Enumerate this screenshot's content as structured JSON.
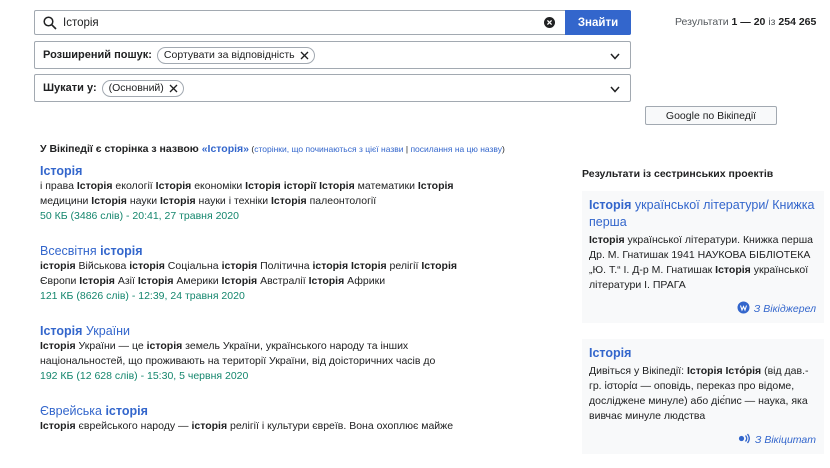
{
  "search": {
    "value": "Історія",
    "button_label": "Знайти"
  },
  "results_count": {
    "prefix": "Результати ",
    "range": "1 — 20",
    "middle": " із ",
    "total": "254 265"
  },
  "advanced": {
    "label": "Розширений пошук:",
    "chip": "Сортувати за відповідність"
  },
  "namespace": {
    "label": "Шукати у:",
    "chip": "(Основний)"
  },
  "google_button": "Google по Вікіпедії",
  "page_exists": {
    "prefix": "У Вікіпедії є сторінка з назвою ",
    "link": "«Історія»",
    "open": " (",
    "starting": "сторінки, що починаються з цієї назви",
    "separator": " | ",
    "links_here": "посилання на цю назву",
    "close": ")"
  },
  "results": [
    {
      "title": [
        {
          "t": "Історія",
          "b": true
        }
      ],
      "lines": [
        [
          {
            "t": "і права "
          },
          {
            "t": "Історія",
            "b": true
          },
          {
            "t": " екології "
          },
          {
            "t": "Історія",
            "b": true
          },
          {
            "t": " економіки "
          },
          {
            "t": "Історія історії Історія",
            "b": true
          },
          {
            "t": " математики "
          },
          {
            "t": "Історія",
            "b": true
          }
        ],
        [
          {
            "t": "медицини "
          },
          {
            "t": "Історія",
            "b": true
          },
          {
            "t": " науки "
          },
          {
            "t": "Історія",
            "b": true
          },
          {
            "t": " науки і техніки "
          },
          {
            "t": "Історія",
            "b": true
          },
          {
            "t": " палеонтології"
          }
        ]
      ],
      "meta": "50 КБ (3486 слів) - 20:41, 27 травня 2020"
    },
    {
      "title": [
        {
          "t": "Всесвітня "
        },
        {
          "t": "історія",
          "b": true
        }
      ],
      "lines": [
        [
          {
            "t": "історія",
            "b": true
          },
          {
            "t": " Військова "
          },
          {
            "t": "історія",
            "b": true
          },
          {
            "t": " Соціальна "
          },
          {
            "t": "історія",
            "b": true
          },
          {
            "t": " Політична "
          },
          {
            "t": "історія Історія",
            "b": true
          },
          {
            "t": " релігії "
          },
          {
            "t": "Історія",
            "b": true
          }
        ],
        [
          {
            "t": "Європи "
          },
          {
            "t": "Історія",
            "b": true
          },
          {
            "t": " Азії "
          },
          {
            "t": "Історія",
            "b": true
          },
          {
            "t": " Америки "
          },
          {
            "t": "Історія",
            "b": true
          },
          {
            "t": " Австралії "
          },
          {
            "t": "Історія",
            "b": true
          },
          {
            "t": " Африки"
          }
        ]
      ],
      "meta": "121 КБ (8626 слів) - 12:39, 24 травня 2020"
    },
    {
      "title": [
        {
          "t": "Історія",
          "b": true
        },
        {
          "t": " України"
        }
      ],
      "lines": [
        [
          {
            "t": "Історія",
            "b": true
          },
          {
            "t": " України — це "
          },
          {
            "t": "історія",
            "b": true
          },
          {
            "t": " земель України, українського народу та інших"
          }
        ],
        [
          {
            "t": "національностей, що проживають на території України, від доісторичних часів до"
          }
        ]
      ],
      "meta": "192 КБ (12 628 слів) - 15:30, 5 червня 2020"
    },
    {
      "title": [
        {
          "t": "Єврейська "
        },
        {
          "t": "історія",
          "b": true
        }
      ],
      "lines": [
        [
          {
            "t": "Історія",
            "b": true
          },
          {
            "t": " єврейського народу — "
          },
          {
            "t": "історія",
            "b": true
          },
          {
            "t": " релігії і культури євреїв. Вона охоплює майже"
          }
        ]
      ],
      "meta": ""
    }
  ],
  "sister": {
    "heading": "Результати із сестринських проектів",
    "cards": [
      {
        "title": [
          {
            "t": "Історія",
            "b": true
          },
          {
            "t": " української літератури/ Книжка перша"
          }
        ],
        "text": [
          {
            "t": "Історія",
            "b": true
          },
          {
            "t": " української літератури. Книжка перша Др. М. Гнатишак 1941 НАУКОВА БІБЛІОТЕКА „Ю. Т.“ І. Д-р М. Гнатишак "
          },
          {
            "t": "Історія",
            "b": true
          },
          {
            "t": " української літератури І. ПРАГА"
          }
        ],
        "link": "З Вікіджерел",
        "icon": "wikisource-icon"
      },
      {
        "title": [
          {
            "t": "Історія",
            "b": true
          }
        ],
        "text": [
          {
            "t": "Дивіться у Вікіпедії: "
          },
          {
            "t": "Історія Істо́рія",
            "b": true
          },
          {
            "t": " (від дав.-гр. ἱστορία — оповідь, переказ про відоме, досліджене минуле) або діє́пис — наука, яка вивчає минуле людства"
          }
        ],
        "link": "З Вікіцитат",
        "icon": "wikiquote-icon"
      }
    ]
  },
  "colors": {
    "link": "#3366cc",
    "meta": "#14866d",
    "button": "#3366cc",
    "card_bg": "#f8f9fa"
  }
}
